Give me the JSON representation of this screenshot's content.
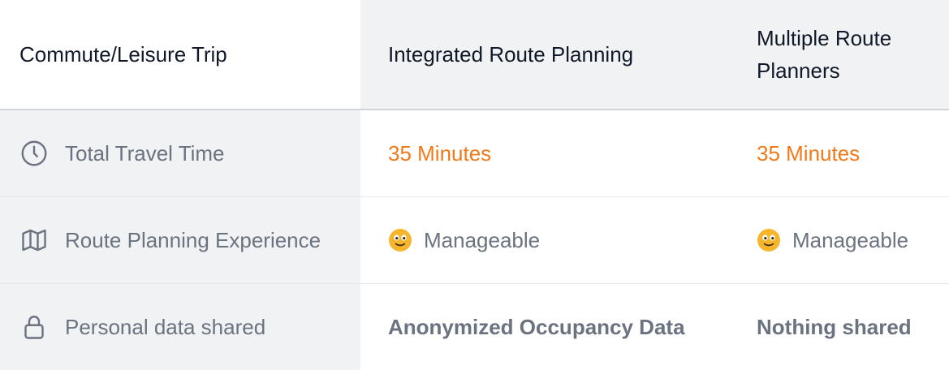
{
  "header": {
    "col1": "Commute/Leisure Trip",
    "col2": "Integrated Route Planning",
    "col3": "Multiple Route Planners"
  },
  "rows": [
    {
      "icon": "clock-icon",
      "label": "Total Travel Time",
      "integrated": "35 Minutes",
      "multiple": "35 Minutes",
      "value_color": "#f07a1a"
    },
    {
      "icon": "map-icon",
      "label": "Route Planning Experience",
      "integrated_emoji": "smiley-face-icon",
      "integrated": "Manageable",
      "multiple_emoji": "smiley-face-icon",
      "multiple": "Manageable"
    },
    {
      "icon": "lock-icon",
      "label": "Personal data shared",
      "integrated": "Anonymized Occupancy Data",
      "multiple": "Nothing shared"
    }
  ]
}
